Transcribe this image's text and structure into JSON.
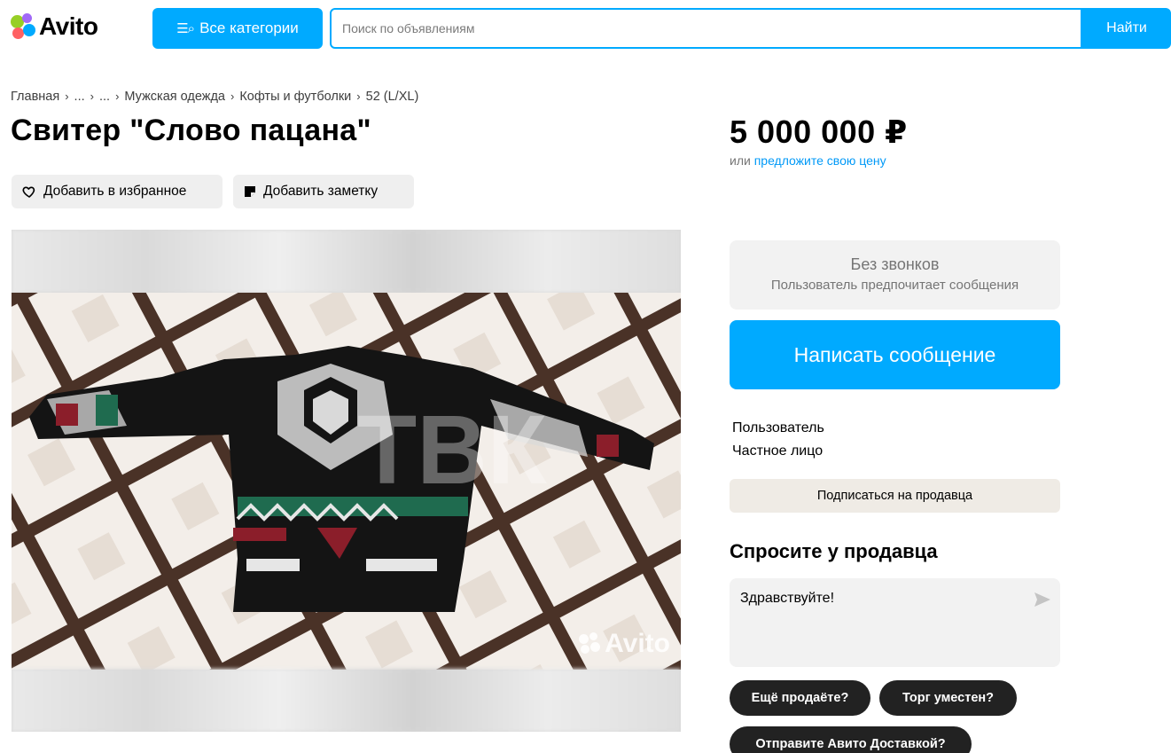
{
  "header": {
    "logo_text": "Avito",
    "categories_label": "Все категории",
    "search_placeholder": "Поиск по объявлениям",
    "find_label": "Найти",
    "brand_color": "#00aaff"
  },
  "breadcrumbs": [
    "Главная",
    "...",
    "...",
    "Мужская одежда",
    "Кофты и футболки",
    "52 (L/XL)"
  ],
  "listing": {
    "title": "Свитер \"Слово пацана\"",
    "price": "5 000 000 ₽",
    "price_offer_prefix": "или",
    "price_offer_link": "предложите свою цену",
    "favorite_label": "Добавить в избранное",
    "note_label": "Добавить заметку"
  },
  "gallery": {
    "watermark_text": "Avito",
    "overlay_watermark": "ТВК"
  },
  "sidebar": {
    "no_calls_title": "Без звонков",
    "no_calls_subtitle": "Пользователь предпочитает сообщения",
    "message_button": "Написать сообщение",
    "seller_name": "Пользователь",
    "seller_type": "Частное лицо",
    "subscribe_label": "Подписаться на продавца",
    "ask_title": "Спросите у продавца",
    "ask_text": "Здравствуйте!",
    "quick_replies": [
      "Ещё продаёте?",
      "Торг уместен?",
      "Отправите Авито Доставкой?"
    ]
  }
}
